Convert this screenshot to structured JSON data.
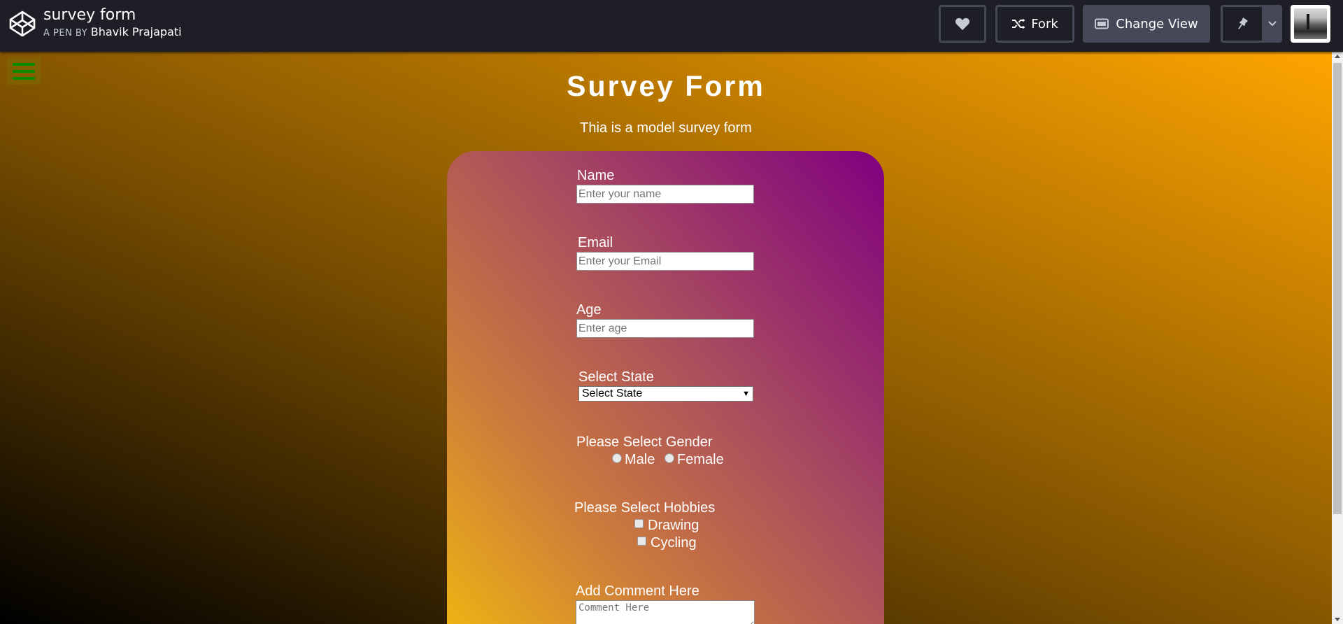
{
  "header": {
    "pen_title": "survey form",
    "pen_by_prefix": "A PEN BY",
    "author": "Bhavik Prajapati",
    "buttons": {
      "fork": "Fork",
      "change_view": "Change View"
    }
  },
  "page": {
    "title": "Survey Form",
    "description": "Thia is a model survey form"
  },
  "form": {
    "name": {
      "label": "Name",
      "placeholder": "Enter your name"
    },
    "email": {
      "label": "Email",
      "placeholder": "Enter your Email"
    },
    "age": {
      "label": "Age",
      "placeholder": "Enter age"
    },
    "state": {
      "label": "Select State",
      "selected": "Select State"
    },
    "gender": {
      "label": "Please Select Gender",
      "options": [
        "Male",
        "Female"
      ]
    },
    "hobbies": {
      "label": "Please Select Hobbies",
      "options": [
        "Drawing",
        "Cycling"
      ]
    },
    "comment": {
      "label": "Add Comment Here",
      "placeholder": "Comment Here"
    }
  },
  "colors": {
    "topbar": "#1e1f26",
    "button_dark": "#444857",
    "hamburger_lines": "#0a8a00",
    "background_gradient": [
      "#000000",
      "#ffa500"
    ],
    "card_gradient": [
      "#f0b90f",
      "#800080"
    ]
  }
}
